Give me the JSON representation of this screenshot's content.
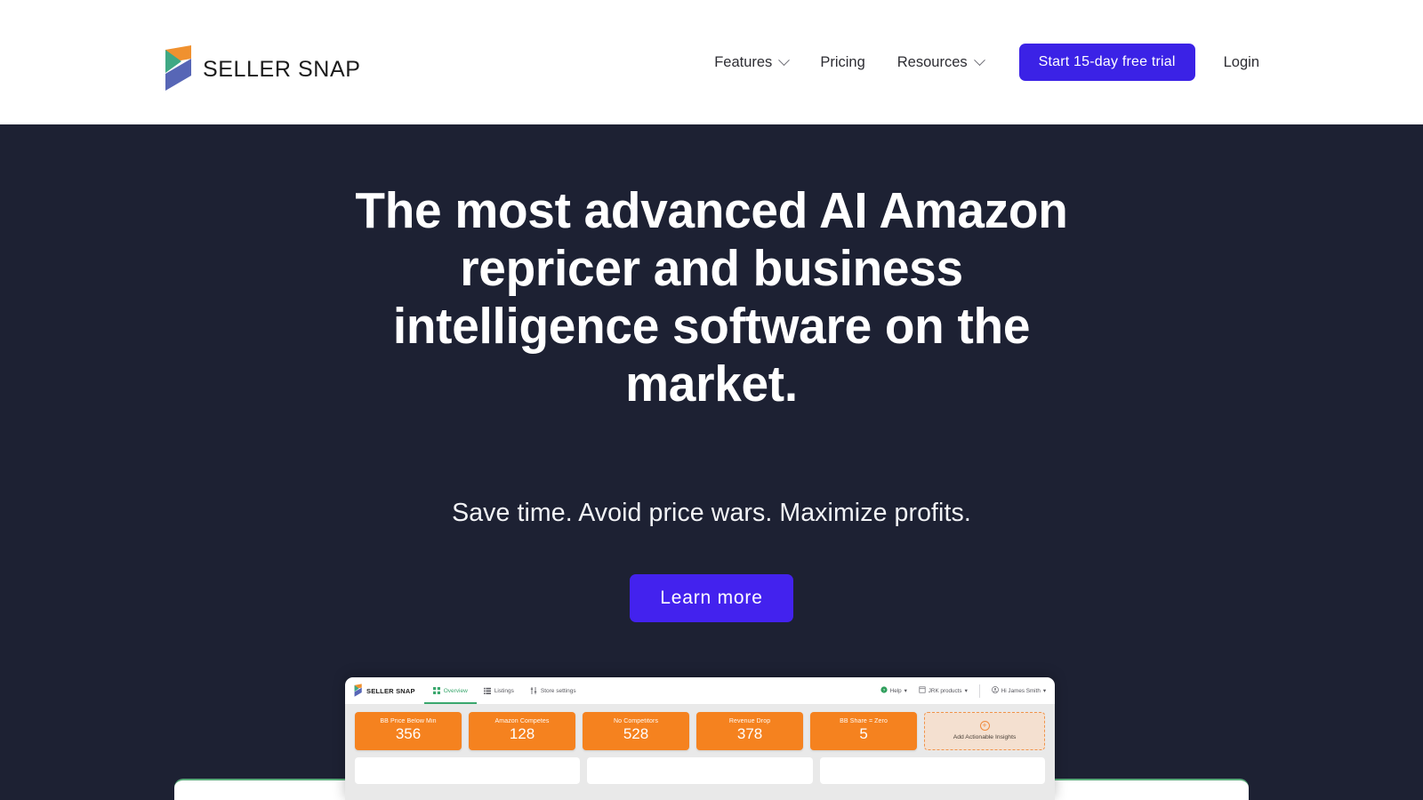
{
  "header": {
    "logo_icon": "seller-snap-chevrons-logo",
    "brand_name": "SELLER SNAP",
    "nav": [
      {
        "label": "Features",
        "has_dropdown": true
      },
      {
        "label": "Pricing",
        "has_dropdown": false
      },
      {
        "label": "Resources",
        "has_dropdown": true
      }
    ],
    "cta_label": "Start 15-day free trial",
    "login_label": "Login"
  },
  "hero": {
    "title": "The most advanced AI Amazon repricer and business intelligence software on the market.",
    "subtitle": "Save time. Avoid price wars. Maximize profits.",
    "button_label": "Learn more",
    "background_color": "#1d2133"
  },
  "dashboard": {
    "brand_name": "SELLER SNAP",
    "tabs": [
      {
        "label": "Overview",
        "icon": "grid-icon",
        "active": true
      },
      {
        "label": "Listings",
        "icon": "list-icon",
        "active": false
      },
      {
        "label": "Store settings",
        "icon": "sliders-icon",
        "active": false
      }
    ],
    "account_items": [
      {
        "label": "Help",
        "icon": "help-circle-icon",
        "caret": "▾"
      },
      {
        "label": "JRK products",
        "icon": "store-icon",
        "caret": "▾"
      },
      {
        "label": "Hi James Smith",
        "icon": "user-circle-icon",
        "caret": "▾"
      }
    ],
    "kpis": [
      {
        "label": "BB Price Below Min",
        "value": "356"
      },
      {
        "label": "Amazon Competes",
        "value": "128"
      },
      {
        "label": "No Competitors",
        "value": "528"
      },
      {
        "label": "Revenue Drop",
        "value": "378"
      },
      {
        "label": "BB Share = Zero",
        "value": "5"
      }
    ],
    "add_card": {
      "icon": "plus-circle-icon",
      "label": "Add Actionable Insights"
    },
    "kpi_color": "#f5821f"
  },
  "colors": {
    "accent_indigo": "#3b22e6",
    "hero_bg": "#1d2133",
    "orange": "#f5821f",
    "green": "#3aa76d",
    "logo_orange": "#f0912f",
    "logo_green": "#3fa884",
    "logo_blue": "#5766b6"
  }
}
